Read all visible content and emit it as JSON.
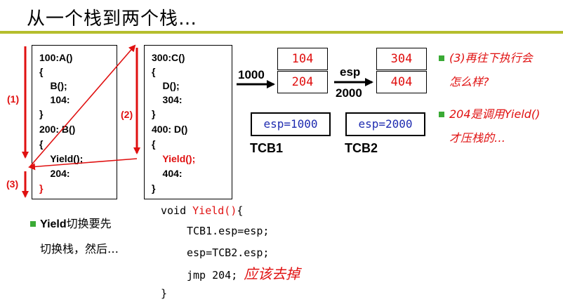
{
  "title": "从一个栈到两个栈…",
  "stack1": {
    "lines": [
      "100:A()",
      "{",
      "    B();",
      "    104:",
      "}",
      "200: B()",
      "{",
      "    Yield();",
      "    204:",
      "}"
    ]
  },
  "stack2": {
    "lines": [
      "300:C()",
      "{",
      "    D();",
      "    304:",
      "}",
      "400: D()",
      "{",
      "    Yield();",
      "    404:",
      "}"
    ]
  },
  "steps": [
    "(1)",
    "(2)",
    "(3)"
  ],
  "arrow_label_1000": "1000",
  "esp_label": "esp",
  "arrow_label_2000": "2000",
  "stackA_cells": [
    "104",
    "204"
  ],
  "stackB_cells": [
    "304",
    "404"
  ],
  "tcb1": {
    "value": "esp=1000",
    "label": "TCB1"
  },
  "tcb2": {
    "value": "esp=2000",
    "label": "TCB2"
  },
  "notes": {
    "q3_line1": "(3)再往下执行会",
    "q3_line2": "怎么样?",
    "q204_line1": "204是调用Yield()",
    "q204_line2": "才压栈的…",
    "yield_line1_bold": "Yield",
    "yield_line1_rest": "切换要先",
    "yield_line2": "切换栈，然后…"
  },
  "yield_code": {
    "sig_prefix": "void ",
    "sig_name": "Yield()",
    "sig_suffix": "{",
    "line1": "TCB1.esp=esp;",
    "line2": "esp=TCB2.esp;",
    "line3_code": "jmp 204; ",
    "line3_comment": "应该去掉",
    "close": "}"
  },
  "colors": {
    "accent_rule": "#b5be2c",
    "bullet": "#3aaa35",
    "red": "#e01010",
    "blue": "#1e2bb0"
  }
}
